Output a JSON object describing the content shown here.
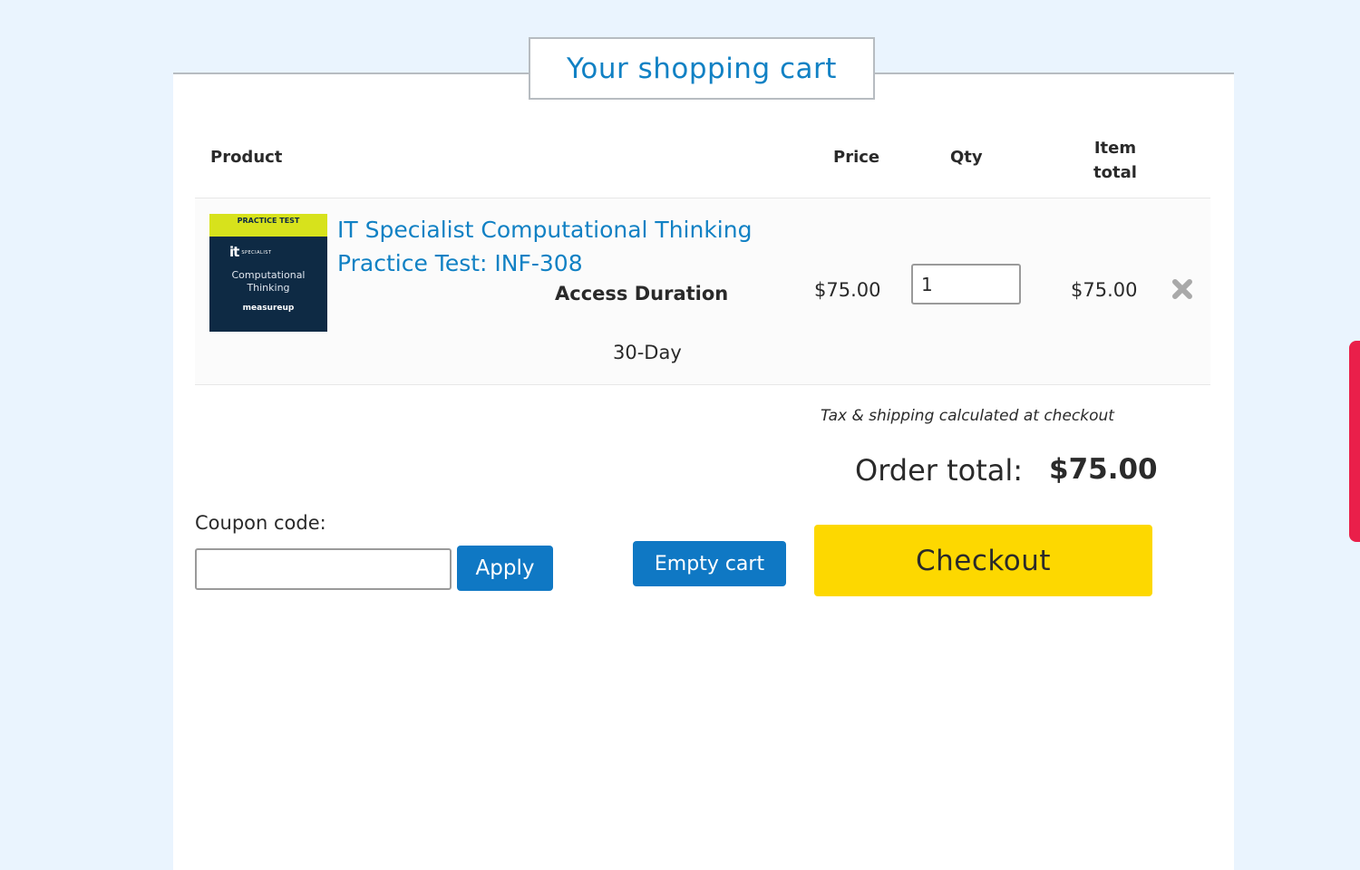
{
  "cart": {
    "title": "Your shopping cart",
    "columns": {
      "product": "Product",
      "price": "Price",
      "qty": "Qty",
      "item_total": "Item total"
    },
    "items": [
      {
        "thumb_band": "PRACTICE TEST",
        "thumb_logo": "it",
        "thumb_logo_sub": "SPECIALIST",
        "thumb_name": "Computational Thinking",
        "thumb_brand": "measureup",
        "name": "IT Specialist Computational Thinking Practice Test: INF-308",
        "option_label": "Access Duration",
        "option_value": "30-Day",
        "price": "$75.00",
        "qty": "1",
        "item_total": "$75.00",
        "remove_icon": "close-x-icon"
      }
    ],
    "tax_note": "Tax & shipping calculated at checkout",
    "order_total_label": "Order total:",
    "order_total_value": "$75.00"
  },
  "coupon": {
    "label": "Coupon code:",
    "value": "",
    "apply_label": "Apply"
  },
  "actions": {
    "empty_cart_label": "Empty cart",
    "checkout_label": "Checkout"
  },
  "colors": {
    "accent_blue": "#1181c4",
    "button_blue": "#0f78c4",
    "checkout_yellow": "#fdd800",
    "side_tab_red": "#ea1f4a",
    "page_background": "#eaf4fe"
  }
}
